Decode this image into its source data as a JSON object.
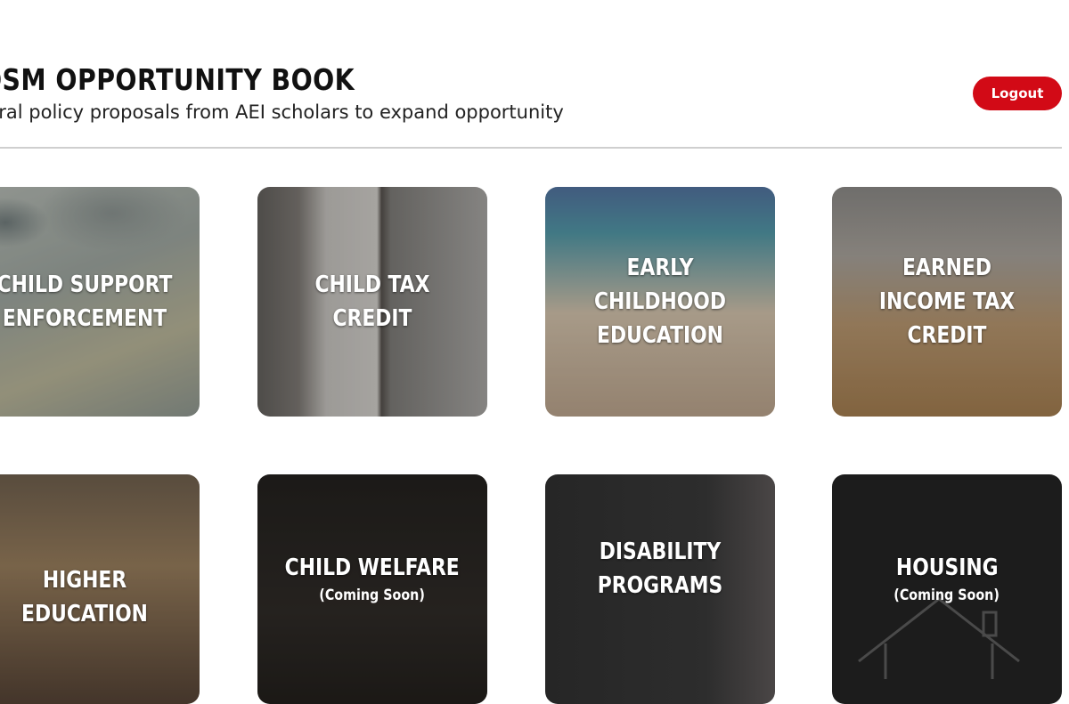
{
  "header": {
    "title": "OSM OPPORTUNITY BOOK",
    "subtitle": "deral policy proposals from AEI scholars to expand opportunity",
    "logout_label": "Logout"
  },
  "colors": {
    "accent": "#d20a16",
    "divider": "#cfcfcf"
  },
  "cards": [
    {
      "title": "Child Support Enforcement",
      "subtitle": ""
    },
    {
      "title": "Child Tax Credit",
      "subtitle": ""
    },
    {
      "title": "Early Childhood Education",
      "subtitle": ""
    },
    {
      "title": "Earned Income Tax Credit",
      "subtitle": ""
    },
    {
      "title": "Higher Education",
      "subtitle": ""
    },
    {
      "title": "Child Welfare",
      "subtitle": "(Coming Soon)"
    },
    {
      "title": "Disability Programs",
      "subtitle": ""
    },
    {
      "title": "Housing",
      "subtitle": "(Coming Soon)"
    }
  ]
}
